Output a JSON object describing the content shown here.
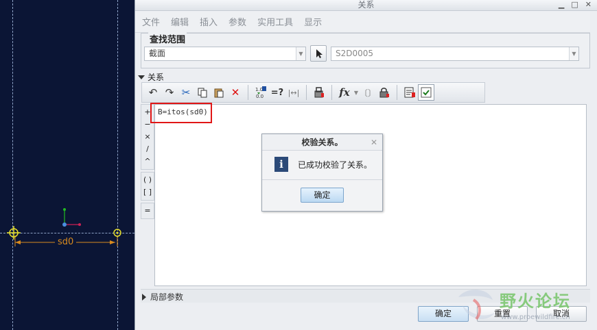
{
  "window": {
    "title": "关系",
    "minimize": "▁",
    "maximize": "□",
    "close": "✕"
  },
  "menu": [
    "文件",
    "编辑",
    "插入",
    "参数",
    "实用工具",
    "显示"
  ],
  "scope": {
    "legend": "查找范围",
    "type_value": "截面",
    "object_value": "S2D0005"
  },
  "relations": {
    "header": "关系",
    "code": "B=itos(sd0)"
  },
  "operators": [
    "+",
    "−",
    "×",
    "/",
    "^",
    "( )",
    "[ ]",
    "="
  ],
  "toolbar": {
    "undo": "↶",
    "redo": "↷",
    "cut": "✂",
    "copy": "⎘",
    "paste": "📋",
    "delete": "✕",
    "verify_eq": "=?",
    "measure": "|↔|",
    "fx": "fx",
    "brackets": "〔〕"
  },
  "local_params": {
    "label": "局部参数"
  },
  "buttons": {
    "ok": "确定",
    "reset": "重置",
    "cancel": "取消"
  },
  "modal": {
    "title": "校验关系。",
    "close": "✕",
    "message": "已成功校验了关系。",
    "ok": "确定"
  },
  "canvas": {
    "dimension": "sd0"
  },
  "watermark": {
    "text": "野火论坛",
    "url": "www.proewildfire.cn"
  },
  "colors": {
    "canvas_bg": "#0b1535",
    "highlight": "#e11616",
    "dimension": "#d88a1e",
    "point": "#e8e02a"
  }
}
